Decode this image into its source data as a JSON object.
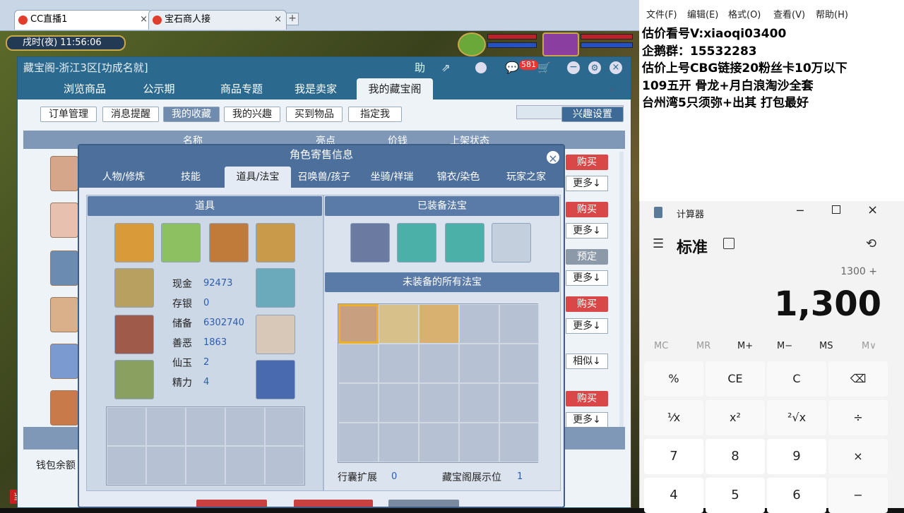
{
  "browser": {
    "tabs": [
      {
        "label": "CC直播1",
        "active": true
      },
      {
        "label": "宝石商人接",
        "active": false
      }
    ],
    "new_tab_label": "+"
  },
  "game": {
    "clock": "戌时(夜)  11:56:06",
    "bottom_left": "当前"
  },
  "cbg": {
    "window_title": "藏宝阁-浙江3区[功成名就]",
    "title_buttons": {
      "help": "助",
      "badge": "581"
    },
    "nav": [
      "浏览商品",
      "公示期",
      "商品专题",
      "我是卖家",
      "我的藏宝阁"
    ],
    "nav_selected": 4,
    "toolbar": [
      "订单管理",
      "消息提醒",
      "我的收藏",
      "我的兴趣",
      "买到物品",
      "指定我"
    ],
    "toolbar_selected": 2,
    "interest_settings": "兴趣设置",
    "list_headers": [
      "名称",
      "亮点",
      "价钱",
      "上架状态"
    ],
    "rows": [
      {
        "action": "购买",
        "sub": "更多↓"
      },
      {
        "action": "购买",
        "sub": "更多↓"
      },
      {
        "action": "预定",
        "sub": "更多↓"
      },
      {
        "action": "购买",
        "sub": "更多↓"
      },
      {
        "action": "",
        "sub": "相似↓"
      },
      {
        "action": "购买",
        "sub": "更多↓"
      }
    ],
    "wallet": "钱包余额"
  },
  "dialog": {
    "title": "角色寄售信息",
    "tabs": [
      "人物/修炼",
      "技能",
      "道具/法宝",
      "召唤兽/孩子",
      "坐骑/祥瑞",
      "锦衣/染色",
      "玩家之家"
    ],
    "tab_selected": 2,
    "items_header": "道具",
    "equipped_header": "已装备法宝",
    "unequipped_header": "未装备的所有法宝",
    "stats": [
      {
        "label": "现金",
        "value": "92473"
      },
      {
        "label": "存银",
        "value": "0"
      },
      {
        "label": "储备",
        "value": "6302740"
      },
      {
        "label": "善恶",
        "value": "1863"
      },
      {
        "label": "仙玉",
        "value": "2"
      },
      {
        "label": "精力",
        "value": "4"
      }
    ],
    "bag_expand_label": "行囊扩展",
    "bag_expand_value": "0",
    "display_label": "藏宝阁展示位",
    "display_value": "1"
  },
  "notepad": {
    "menu": [
      "文件(F)",
      "编辑(E)",
      "格式(O)",
      "查看(V)",
      "帮助(H)"
    ],
    "lines": [
      "估价看号V:xiaoqi03400",
      "企鹅群：15532283",
      "估价上号CBG链接20粉丝卡10万以下",
      "109五开 骨龙+月白浪淘沙全套",
      "台州湾5只须弥+出其 打包最好"
    ]
  },
  "calculator": {
    "app_title": "计算器",
    "mode": "标准",
    "expression": "1300 +",
    "display": "1,300",
    "memory": [
      "MC",
      "MR",
      "M+",
      "M−",
      "MS",
      "M∨"
    ],
    "keys": [
      "%",
      "CE",
      "C",
      "⌫",
      "¹⁄x",
      "x²",
      "²√x",
      "÷",
      "7",
      "8",
      "9",
      "×",
      "4",
      "5",
      "6",
      "−"
    ]
  },
  "colors": {
    "window_blue": "#2b6a8e",
    "dialog_blue": "#4c6f9c",
    "buy_red": "#d84848"
  }
}
